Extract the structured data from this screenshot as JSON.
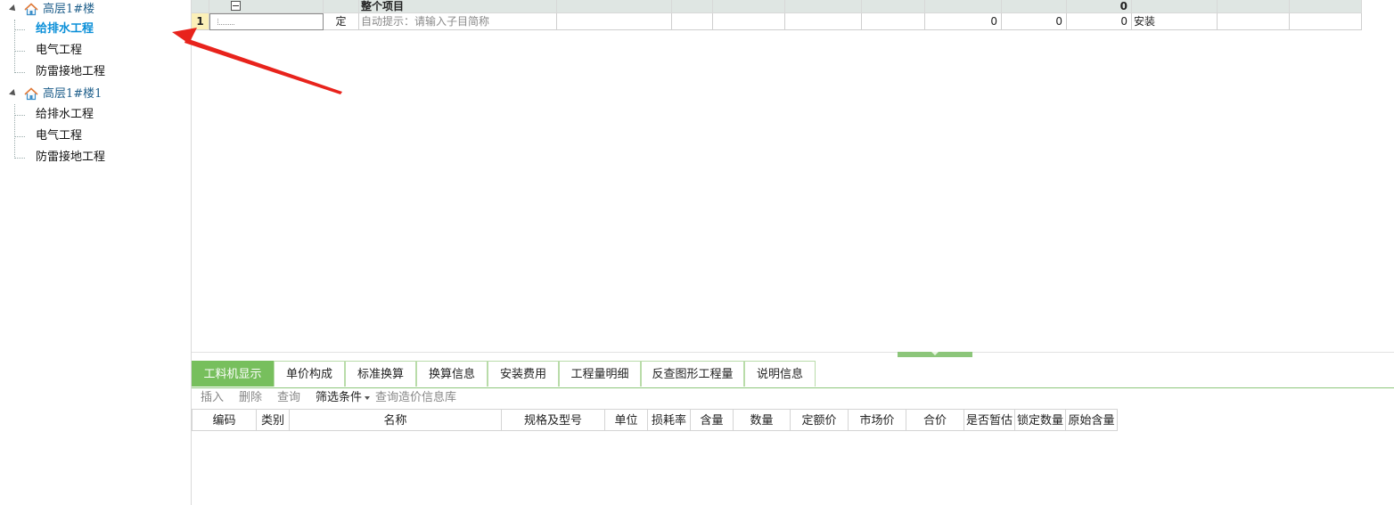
{
  "tree": {
    "groups": [
      {
        "label": "高层1#楼",
        "children": [
          "给排水工程",
          "电气工程",
          "防雷接地工程"
        ],
        "selected_index": 0
      },
      {
        "label": "高层1#楼1",
        "children": [
          "给排水工程",
          "电气工程",
          "防雷接地工程"
        ],
        "selected_index": -1
      }
    ]
  },
  "grid": {
    "header_row": {
      "name": "整个项目",
      "total": "0"
    },
    "row1": {
      "index": "1",
      "type": "定",
      "name_placeholder": "自动提示：请输入子目简称",
      "v1": "0",
      "v2": "0",
      "v3": "0",
      "category": "安装"
    }
  },
  "tabs": [
    "工料机显示",
    "单价构成",
    "标准换算",
    "换算信息",
    "安装费用",
    "工程量明细",
    "反查图形工程量",
    "说明信息"
  ],
  "active_tab": "工料机显示",
  "toolbar": {
    "insert": "插入",
    "delete": "删除",
    "query": "查询",
    "filter": "筛选条件",
    "query_price": "查询造价信息库"
  },
  "material_columns": [
    "编码",
    "类别",
    "名称",
    "规格及型号",
    "单位",
    "损耗率",
    "含量",
    "数量",
    "定额价",
    "市场价",
    "合价",
    "是否暂估",
    "锁定数量",
    "原始含量"
  ],
  "colors": {
    "accent_green": "#77bf5d",
    "selected_text": "#0a8fd8",
    "arrow_red": "#e8231c",
    "row_number_bg": "#fbf0b8"
  }
}
